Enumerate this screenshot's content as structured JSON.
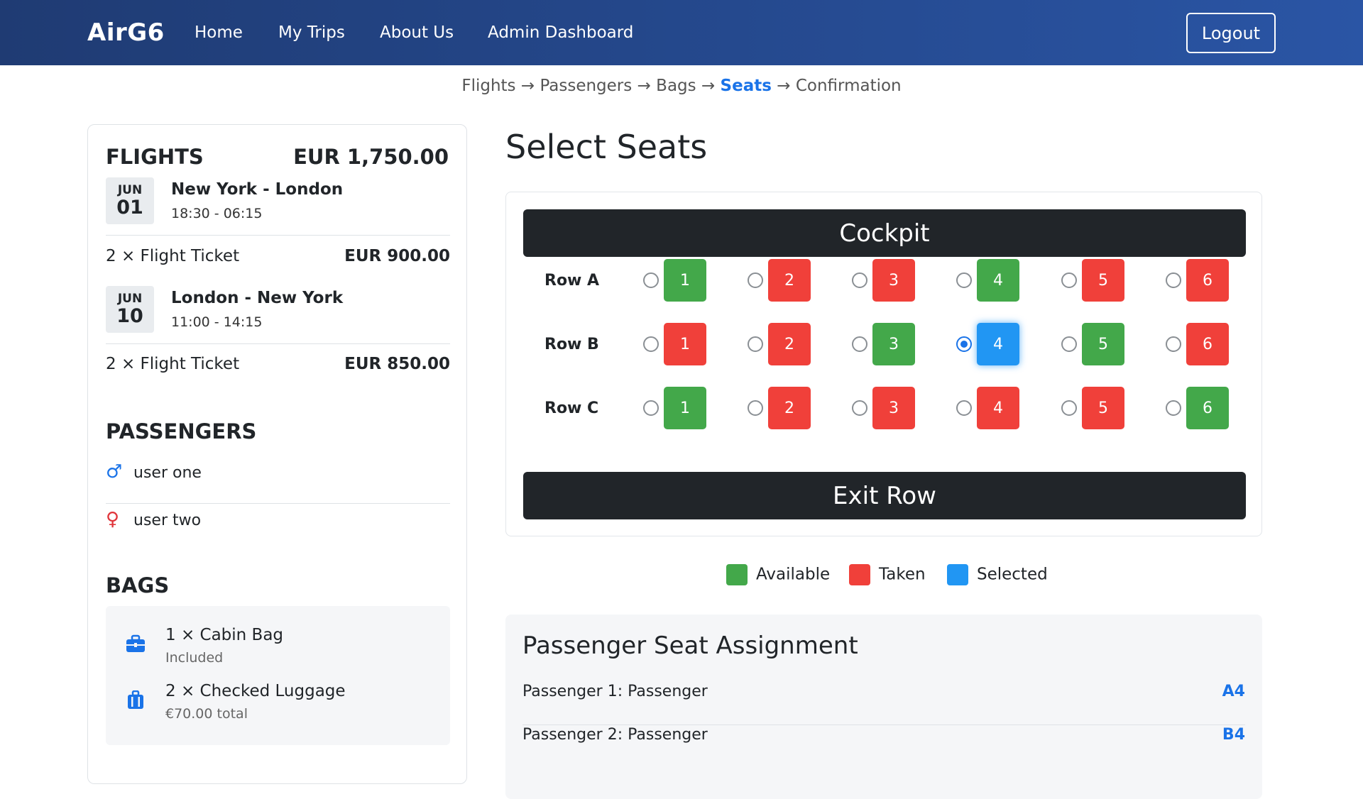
{
  "nav": {
    "brand": "AirG6",
    "links": [
      "Home",
      "My Trips",
      "About Us",
      "Admin Dashboard"
    ],
    "logout": "Logout",
    "background": "#24478e"
  },
  "breadcrumb": {
    "steps": [
      "Flights",
      "Passengers",
      "Bags",
      "Seats",
      "Confirmation"
    ],
    "separator": "→",
    "active": "Seats"
  },
  "summary": {
    "flights_title": "FLIGHTS",
    "total": "EUR 1,750.00",
    "flights": [
      {
        "month": "JUN",
        "day": "01",
        "route": "New York - London",
        "times": "18:30 - 06:15",
        "ticket": "2 × Flight Ticket",
        "price": "EUR 900.00"
      },
      {
        "month": "JUN",
        "day": "10",
        "route": "London - New York",
        "times": "11:00 - 14:15",
        "ticket": "2 × Flight Ticket",
        "price": "EUR 850.00"
      }
    ],
    "passengers_title": "PASSENGERS",
    "passengers": [
      {
        "name": "user one",
        "icon": "male-icon"
      },
      {
        "name": "user two",
        "icon": "female-icon"
      }
    ],
    "bags_title": "BAGS",
    "bags": [
      {
        "name": "1 × Cabin Bag",
        "sub": "Included",
        "icon": "briefcase-icon"
      },
      {
        "name": "2 × Checked Luggage",
        "sub": "€70.00 total",
        "icon": "suitcase-icon"
      }
    ]
  },
  "seat_map": {
    "title": "Select Seats",
    "cockpit": "Cockpit",
    "exit_row": "Exit Row",
    "rows": [
      {
        "label": "Row A",
        "seats": [
          {
            "num": "1",
            "status": "available"
          },
          {
            "num": "2",
            "status": "taken"
          },
          {
            "num": "3",
            "status": "taken"
          },
          {
            "num": "4",
            "status": "available"
          },
          {
            "num": "5",
            "status": "taken"
          },
          {
            "num": "6",
            "status": "taken"
          }
        ]
      },
      {
        "label": "Row B",
        "seats": [
          {
            "num": "1",
            "status": "taken"
          },
          {
            "num": "2",
            "status": "taken"
          },
          {
            "num": "3",
            "status": "available"
          },
          {
            "num": "4",
            "status": "selected"
          },
          {
            "num": "5",
            "status": "available"
          },
          {
            "num": "6",
            "status": "taken"
          }
        ]
      },
      {
        "label": "Row C",
        "seats": [
          {
            "num": "1",
            "status": "available"
          },
          {
            "num": "2",
            "status": "taken"
          },
          {
            "num": "3",
            "status": "taken"
          },
          {
            "num": "4",
            "status": "taken"
          },
          {
            "num": "5",
            "status": "taken"
          },
          {
            "num": "6",
            "status": "available"
          }
        ]
      }
    ],
    "colors": {
      "available": "#43a84a",
      "taken": "#f0403a",
      "selected": "#2196f3"
    }
  },
  "legend": {
    "available": "Available",
    "taken": "Taken",
    "selected": "Selected"
  },
  "assignment": {
    "title": "Passenger Seat Assignment",
    "rows": [
      {
        "label": "Passenger 1: Passenger",
        "seat": "A4"
      },
      {
        "label": "Passenger 2: Passenger",
        "seat": "B4"
      }
    ]
  }
}
